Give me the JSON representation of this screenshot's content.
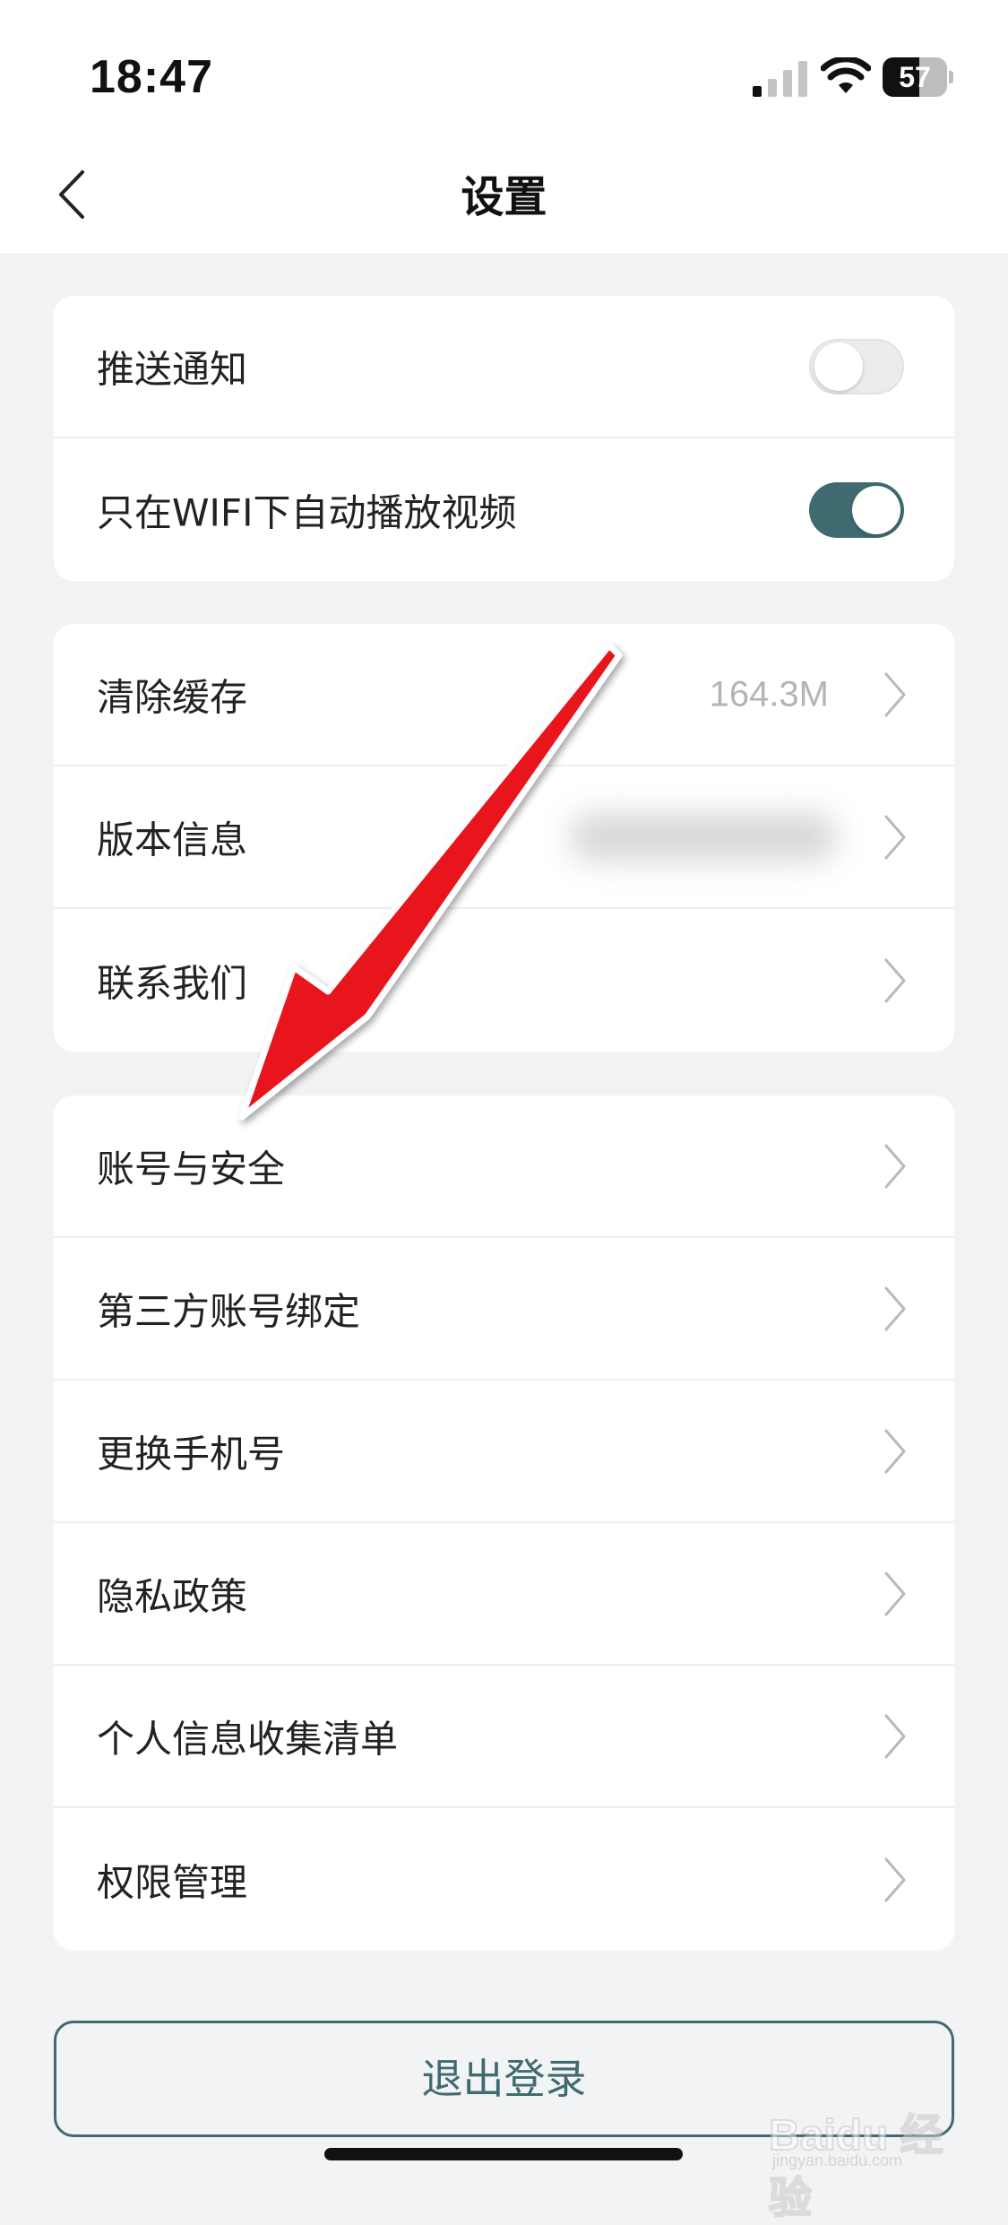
{
  "status_bar": {
    "time": "18:47",
    "battery_level": "57",
    "battery_fraction": 0.57
  },
  "nav": {
    "title": "设置",
    "back_icon": "chevron-left-icon"
  },
  "toggles_group": [
    {
      "label": "推送通知",
      "enabled": false
    },
    {
      "label": "只在WIFI下自动播放视频",
      "enabled": true
    }
  ],
  "info_group": [
    {
      "label": "清除缓存",
      "value": "164.3M"
    },
    {
      "label": "版本信息",
      "value_blurred": true
    },
    {
      "label": "联系我们"
    }
  ],
  "account_group": [
    {
      "label": "账号与安全"
    },
    {
      "label": "第三方账号绑定"
    },
    {
      "label": "更换手机号"
    },
    {
      "label": "隐私政策"
    },
    {
      "label": "个人信息收集清单"
    },
    {
      "label": "权限管理"
    }
  ],
  "logout": {
    "label": "退出登录"
  },
  "watermark": {
    "text": "Baidu 经验",
    "sub": "jingyan.baidu.com"
  },
  "colors": {
    "accent": "#3f6b70",
    "annotation": "#e8121b",
    "background": "#f2f3f5"
  }
}
